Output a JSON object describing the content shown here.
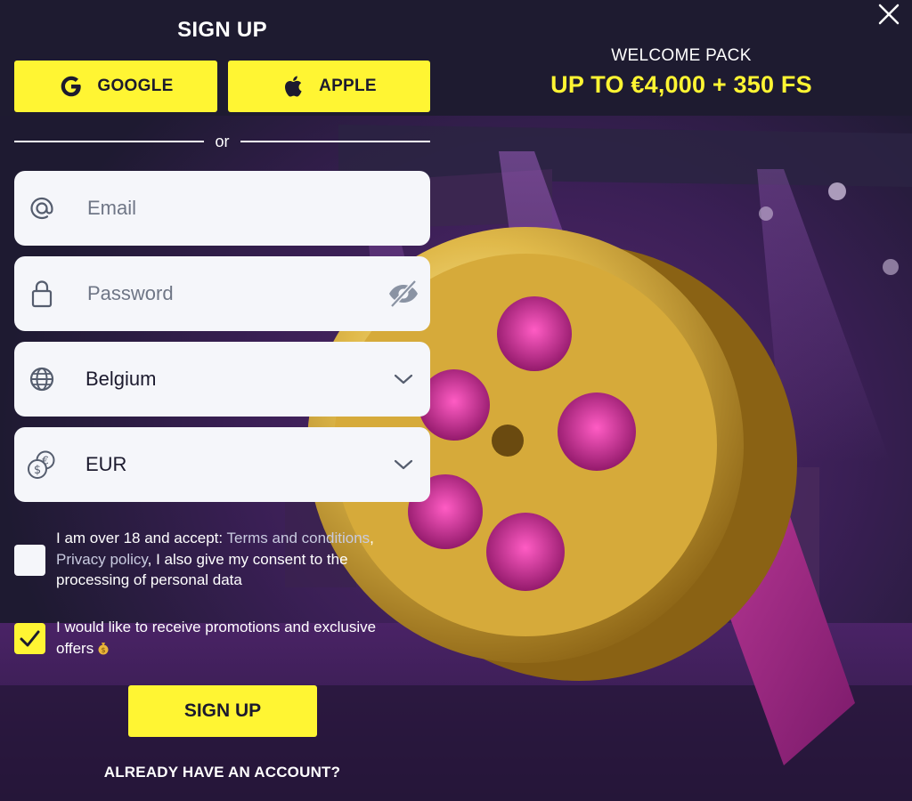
{
  "header": {
    "title": "SIGN UP",
    "close_icon": "close-icon"
  },
  "promo": {
    "subtitle": "WELCOME PACK",
    "offer": "UP TO €4,000 + 350 FS",
    "illustration": "film-reel"
  },
  "social": {
    "google_label": "GOOGLE",
    "apple_label": "APPLE",
    "google_icon": "google-icon",
    "apple_icon": "apple-icon"
  },
  "divider": {
    "text": "or"
  },
  "form": {
    "email": {
      "placeholder": "Email",
      "value": "",
      "icon": "at-icon"
    },
    "password": {
      "placeholder": "Password",
      "value": "",
      "icon": "lock-icon",
      "toggle_icon": "eye-off-icon"
    },
    "country": {
      "value": "Belgium",
      "icon": "globe-icon",
      "chevron": "chevron-down-icon"
    },
    "currency": {
      "value": "EUR",
      "icon": "coins-icon",
      "chevron": "chevron-down-icon"
    }
  },
  "terms": {
    "checked": false,
    "text_before": "I am over 18 and accept: ",
    "terms_link": "Terms and conditions",
    "comma": ",",
    "privacy_link": "Privacy policy",
    "text_after": ", I also give my consent to the processing of personal data"
  },
  "promotions": {
    "checked": true,
    "text": "I would like to receive promotions and exclusive offers",
    "emoji_icon": "money-bag-icon"
  },
  "submit_label": "SIGN UP",
  "login_link": "ALREADY HAVE AN ACCOUNT?",
  "colors": {
    "accent": "#fff533",
    "background": "#201c33",
    "field": "#f5f6fa",
    "magenta": "#d42f9e"
  }
}
